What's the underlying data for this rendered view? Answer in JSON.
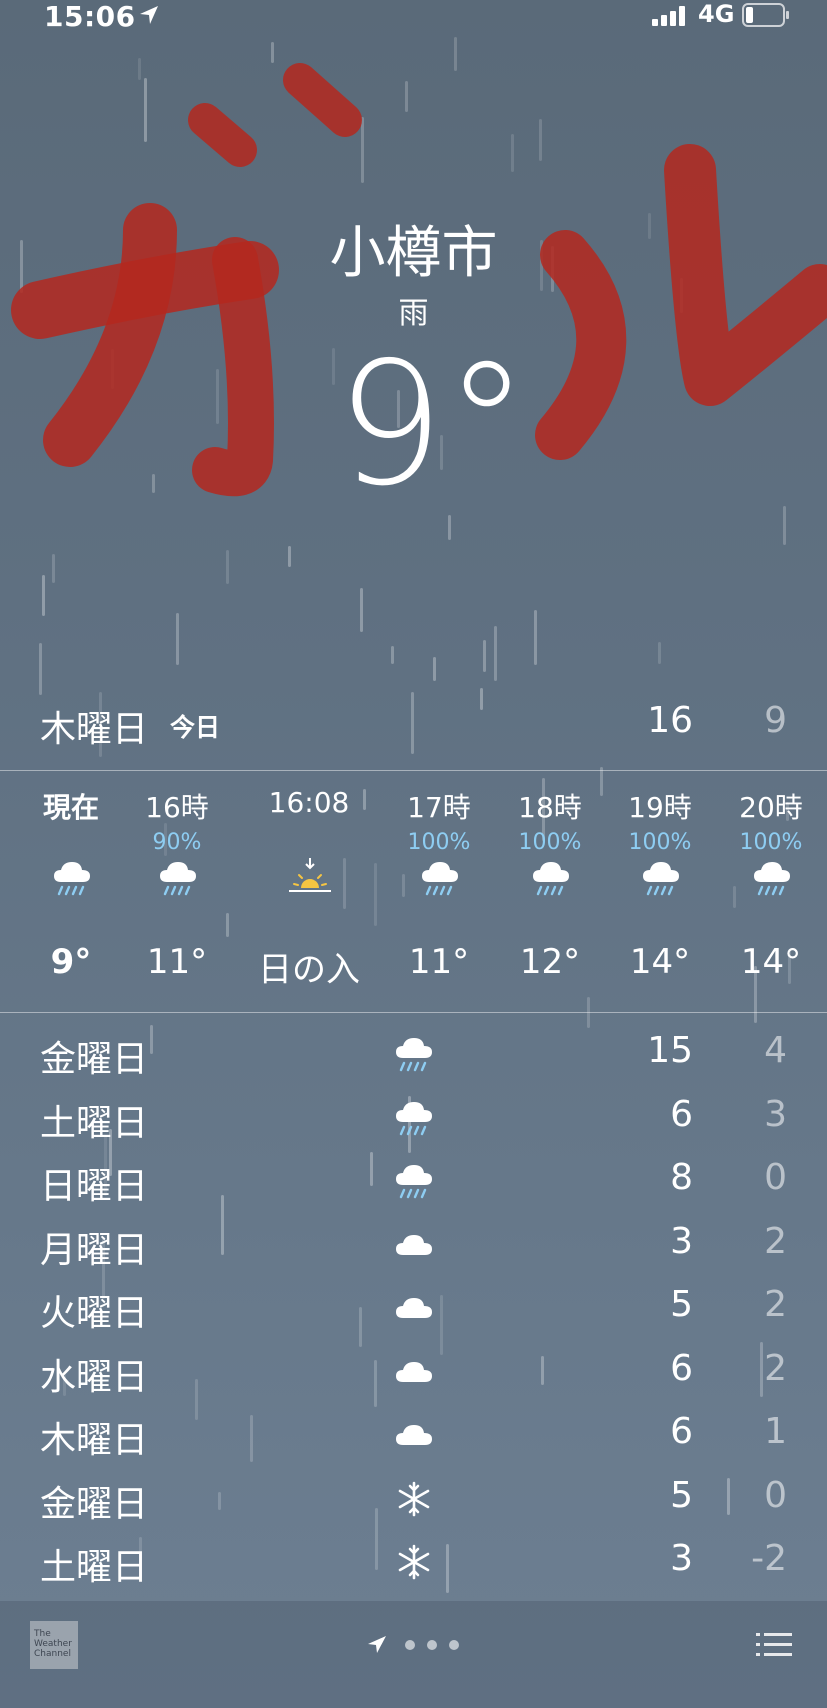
{
  "status": {
    "time": "15:06",
    "network": "4G"
  },
  "location": {
    "city": "小樽市",
    "condition": "雨",
    "temperature": "9°"
  },
  "today": {
    "day": "木曜日",
    "tag": "今日",
    "high": "16",
    "low": "9"
  },
  "hourly": [
    {
      "label": "現在",
      "precip": "",
      "icon": "rain-cloud-icon",
      "temp": "9°"
    },
    {
      "label": "16時",
      "precip": "90%",
      "icon": "rain-cloud-icon",
      "temp": "11°"
    },
    {
      "label": "16:08",
      "precip": "",
      "icon": "sunset-icon",
      "temp": "日の入"
    },
    {
      "label": "17時",
      "precip": "100%",
      "icon": "rain-cloud-icon",
      "temp": "11°"
    },
    {
      "label": "18時",
      "precip": "100%",
      "icon": "rain-cloud-icon",
      "temp": "12°"
    },
    {
      "label": "19時",
      "precip": "100%",
      "icon": "rain-cloud-icon",
      "temp": "14°"
    },
    {
      "label": "20時",
      "precip": "100%",
      "icon": "rain-cloud-icon",
      "temp": "14°"
    }
  ],
  "daily": [
    {
      "day": "金曜日",
      "icon": "rain-cloud-icon",
      "high": "15",
      "low": "4"
    },
    {
      "day": "土曜日",
      "icon": "rain-cloud-icon",
      "high": "6",
      "low": "3"
    },
    {
      "day": "日曜日",
      "icon": "rain-cloud-icon",
      "high": "8",
      "low": "0"
    },
    {
      "day": "月曜日",
      "icon": "cloud-icon",
      "high": "3",
      "low": "2"
    },
    {
      "day": "火曜日",
      "icon": "cloud-icon",
      "high": "5",
      "low": "2"
    },
    {
      "day": "水曜日",
      "icon": "cloud-icon",
      "high": "6",
      "low": "2"
    },
    {
      "day": "木曜日",
      "icon": "cloud-icon",
      "high": "6",
      "low": "1"
    },
    {
      "day": "金曜日",
      "icon": "snowflake-icon",
      "high": "5",
      "low": "0"
    },
    {
      "day": "土曜日",
      "icon": "snowflake-icon",
      "high": "3",
      "low": "-2"
    }
  ],
  "footer": {
    "logo": "The Weather Channel"
  },
  "overlay": {
    "text": "ガル",
    "color": "#b4281e"
  },
  "colors": {
    "precip": "#8ecdf2",
    "sun": "#f5c542"
  }
}
